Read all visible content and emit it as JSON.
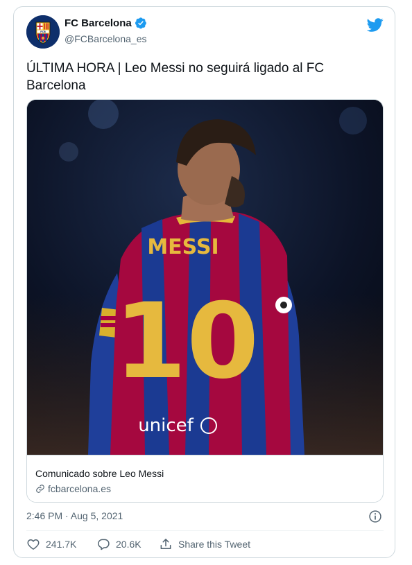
{
  "account": {
    "name": "FC Barcelona",
    "handle": "@FCBarcelona_es",
    "verified": true,
    "crest_letters": "FCB"
  },
  "tweet": {
    "text": "ÚLTIMA HORA | Leo Messi no seguirá ligado al FC Barcelona"
  },
  "link_card": {
    "title": "Comunicado sobre Leo Messi",
    "domain": "fcbarcelona.es",
    "image": {
      "shirt_name": "MESSI",
      "shirt_number": "10",
      "sponsor": "unicef"
    }
  },
  "meta": {
    "timestamp": "2:46 PM · Aug 5, 2021"
  },
  "actions": {
    "likes": "241.7K",
    "replies": "20.6K",
    "share_label": "Share this Tweet"
  },
  "colors": {
    "twitter_blue": "#1d9bf0",
    "text_primary": "#0f1419",
    "text_secondary": "#536471",
    "border": "#cfd9de"
  }
}
